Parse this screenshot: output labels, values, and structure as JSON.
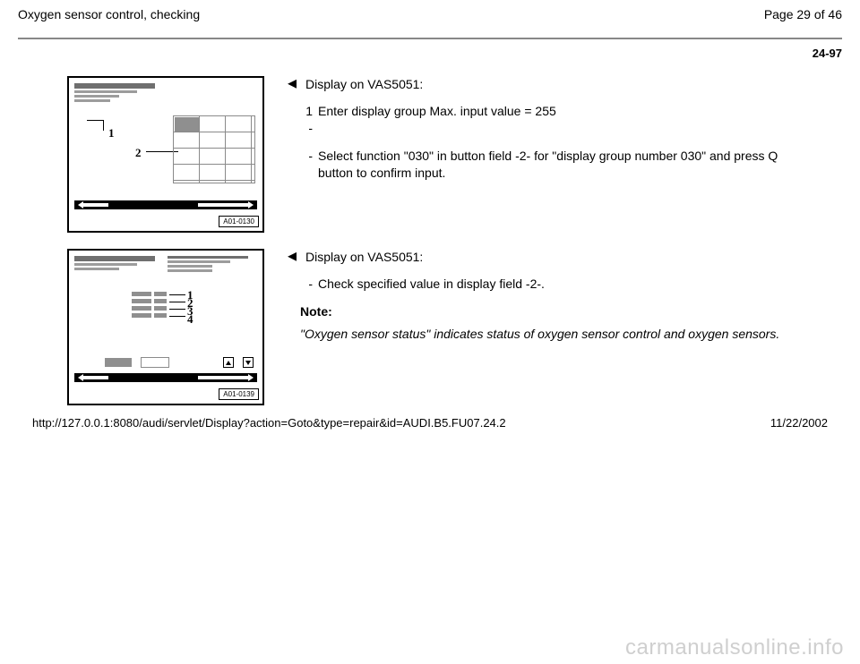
{
  "header": {
    "title": "Oxygen sensor control, checking",
    "page_of": "Page 29 of 46",
    "code": "24-97"
  },
  "rows": [
    {
      "fig": {
        "label": "A01-0130",
        "type": "fig1",
        "callouts": [
          "1",
          "2"
        ]
      },
      "heading": "Display on VAS5051:",
      "steps": [
        {
          "marker": "1 -",
          "text": "Enter display group Max. input value = 255"
        },
        {
          "marker": "-",
          "text": "Select function \"030\" in button field -2- for \"display group number 030\" and press Q button to confirm input."
        }
      ]
    },
    {
      "fig": {
        "label": "A01-0139",
        "type": "fig2",
        "callouts": [
          "1",
          "2",
          "3",
          "4"
        ]
      },
      "heading": "Display on VAS5051:",
      "steps": [
        {
          "marker": "-",
          "text": "Check specified value in display field -2-."
        }
      ],
      "note": {
        "label": "Note:",
        "text": "\"Oxygen sensor status\" indicates status of oxygen sensor control and oxygen sensors."
      }
    }
  ],
  "footer": {
    "url": "http://127.0.0.1:8080/audi/servlet/Display?action=Goto&type=repair&id=AUDI.B5.FU07.24.2",
    "date": "11/22/2002"
  },
  "watermark": "carmanualsonline.info"
}
